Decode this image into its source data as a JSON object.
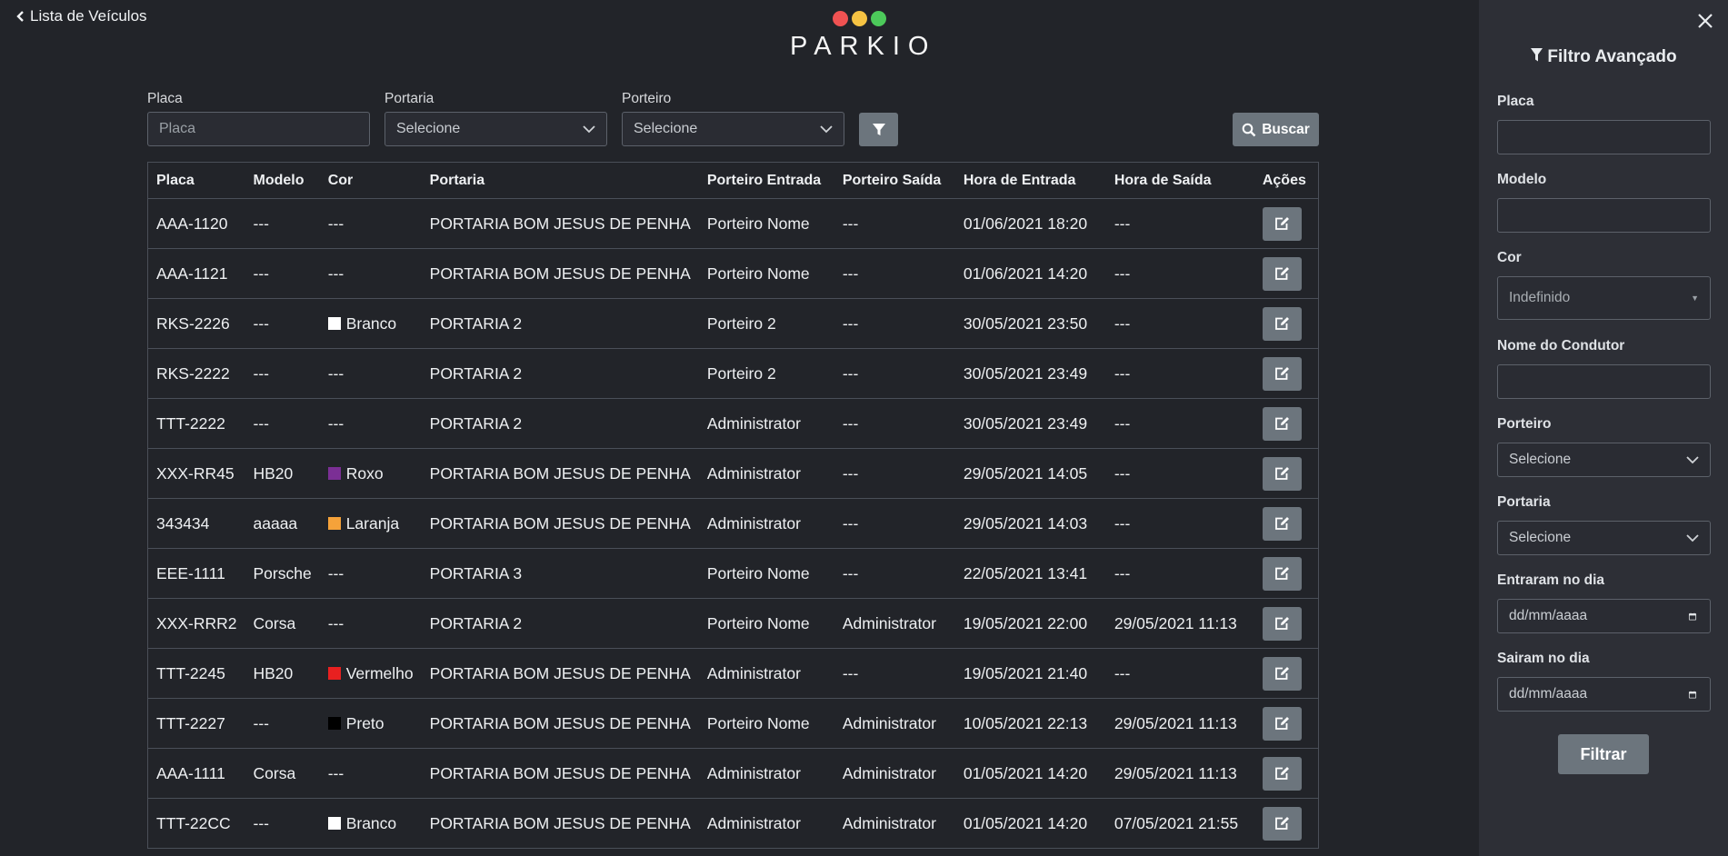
{
  "back_link": "Lista de Veículos",
  "logo": {
    "text": "PARKIO",
    "dots": [
      "#f05252",
      "#f6c343",
      "#4cc95a"
    ]
  },
  "filters": {
    "placa_label": "Placa",
    "placa_placeholder": "Placa",
    "portaria_label": "Portaria",
    "portaria_value": "Selecione",
    "porteiro_label": "Porteiro",
    "porteiro_value": "Selecione",
    "buscar_label": "Buscar"
  },
  "table": {
    "headers": [
      "Placa",
      "Modelo",
      "Cor",
      "Portaria",
      "Porteiro Entrada",
      "Porteiro Saída",
      "Hora de Entrada",
      "Hora de Saída",
      "Ações"
    ],
    "rows": [
      {
        "placa": "AAA-1120",
        "modelo": "---",
        "cor": "---",
        "cor_hex": "",
        "portaria": "PORTARIA BOM JESUS DE PENHA",
        "porteiro_entrada": "Porteiro Nome",
        "porteiro_saida": "---",
        "hora_entrada": "01/06/2021 18:20",
        "hora_saida": "---"
      },
      {
        "placa": "AAA-1121",
        "modelo": "---",
        "cor": "---",
        "cor_hex": "",
        "portaria": "PORTARIA BOM JESUS DE PENHA",
        "porteiro_entrada": "Porteiro Nome",
        "porteiro_saida": "---",
        "hora_entrada": "01/06/2021 14:20",
        "hora_saida": "---"
      },
      {
        "placa": "RKS-2226",
        "modelo": "---",
        "cor": "Branco",
        "cor_hex": "#ffffff",
        "portaria": "PORTARIA 2",
        "porteiro_entrada": "Porteiro 2",
        "porteiro_saida": "---",
        "hora_entrada": "30/05/2021 23:50",
        "hora_saida": "---"
      },
      {
        "placa": "RKS-2222",
        "modelo": "---",
        "cor": "---",
        "cor_hex": "",
        "portaria": "PORTARIA 2",
        "porteiro_entrada": "Porteiro 2",
        "porteiro_saida": "---",
        "hora_entrada": "30/05/2021 23:49",
        "hora_saida": "---"
      },
      {
        "placa": "TTT-2222",
        "modelo": "---",
        "cor": "---",
        "cor_hex": "",
        "portaria": "PORTARIA 2",
        "porteiro_entrada": "Administrator",
        "porteiro_saida": "---",
        "hora_entrada": "30/05/2021 23:49",
        "hora_saida": "---"
      },
      {
        "placa": "XXX-RR45",
        "modelo": "HB20",
        "cor": "Roxo",
        "cor_hex": "#7b2f95",
        "portaria": "PORTARIA BOM JESUS DE PENHA",
        "porteiro_entrada": "Administrator",
        "porteiro_saida": "---",
        "hora_entrada": "29/05/2021 14:05",
        "hora_saida": "---"
      },
      {
        "placa": "343434",
        "modelo": "aaaaa",
        "cor": "Laranja",
        "cor_hex": "#f5a23a",
        "portaria": "PORTARIA BOM JESUS DE PENHA",
        "porteiro_entrada": "Administrator",
        "porteiro_saida": "---",
        "hora_entrada": "29/05/2021 14:03",
        "hora_saida": "---"
      },
      {
        "placa": "EEE-1111",
        "modelo": "Porsche",
        "cor": "---",
        "cor_hex": "",
        "portaria": "PORTARIA 3",
        "porteiro_entrada": "Porteiro Nome",
        "porteiro_saida": "---",
        "hora_entrada": "22/05/2021 13:41",
        "hora_saida": "---"
      },
      {
        "placa": "XXX-RRR2",
        "modelo": "Corsa",
        "cor": "---",
        "cor_hex": "",
        "portaria": "PORTARIA 2",
        "porteiro_entrada": "Porteiro Nome",
        "porteiro_saida": "Administrator",
        "hora_entrada": "19/05/2021 22:00",
        "hora_saida": "29/05/2021 11:13"
      },
      {
        "placa": "TTT-2245",
        "modelo": "HB20",
        "cor": "Vermelho",
        "cor_hex": "#e82020",
        "portaria": "PORTARIA BOM JESUS DE PENHA",
        "porteiro_entrada": "Administrator",
        "porteiro_saida": "---",
        "hora_entrada": "19/05/2021 21:40",
        "hora_saida": "---"
      },
      {
        "placa": "TTT-2227",
        "modelo": "---",
        "cor": "Preto",
        "cor_hex": "#000000",
        "portaria": "PORTARIA BOM JESUS DE PENHA",
        "porteiro_entrada": "Porteiro Nome",
        "porteiro_saida": "Administrator",
        "hora_entrada": "10/05/2021 22:13",
        "hora_saida": "29/05/2021 11:13"
      },
      {
        "placa": "AAA-1111",
        "modelo": "Corsa",
        "cor": "---",
        "cor_hex": "",
        "portaria": "PORTARIA BOM JESUS DE PENHA",
        "porteiro_entrada": "Administrator",
        "porteiro_saida": "Administrator",
        "hora_entrada": "01/05/2021 14:20",
        "hora_saida": "29/05/2021 11:13"
      },
      {
        "placa": "TTT-22CC",
        "modelo": "---",
        "cor": "Branco",
        "cor_hex": "#ffffff",
        "portaria": "PORTARIA BOM JESUS DE PENHA",
        "porteiro_entrada": "Administrator",
        "porteiro_saida": "Administrator",
        "hora_entrada": "01/05/2021 14:20",
        "hora_saida": "07/05/2021 21:55"
      }
    ]
  },
  "sidebar": {
    "title": "Filtro Avançado",
    "placa_label": "Placa",
    "modelo_label": "Modelo",
    "cor_label": "Cor",
    "cor_value": "Indefinido",
    "condutor_label": "Nome do Condutor",
    "porteiro_label": "Porteiro",
    "porteiro_value": "Selecione",
    "portaria_label": "Portaria",
    "portaria_value": "Selecione",
    "entraram_label": "Entraram no dia",
    "entraram_placeholder": "dd/mm/aaaa",
    "sairam_label": "Sairam no dia",
    "sairam_placeholder": "dd/mm/aaaa",
    "filtrar_label": "Filtrar"
  }
}
